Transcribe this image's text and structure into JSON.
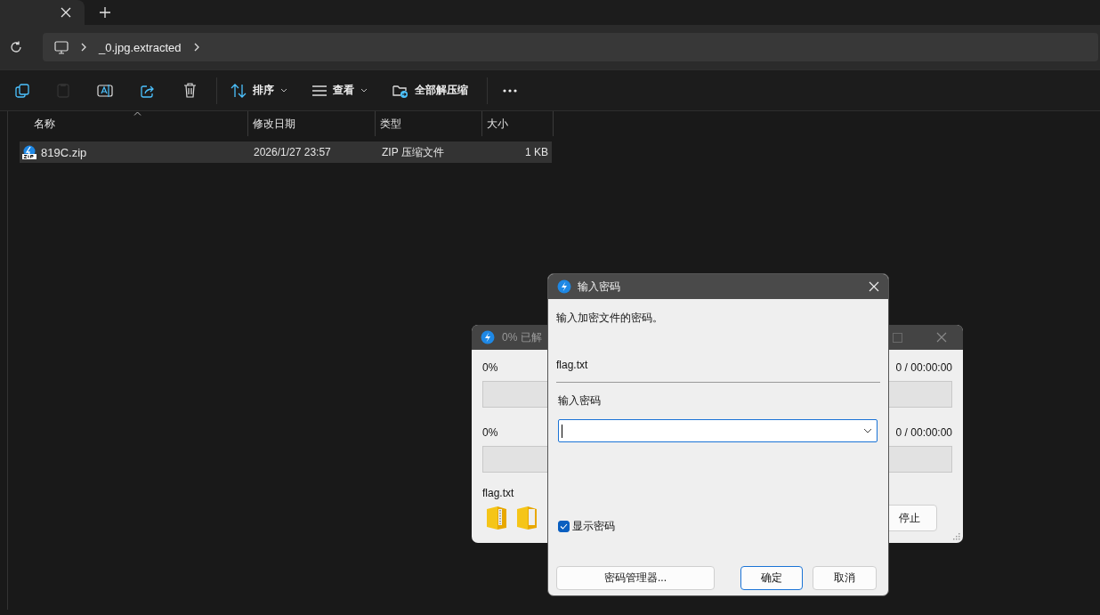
{
  "address_bar": {
    "segments": [
      "_0.jpg.extracted"
    ]
  },
  "toolbar": {
    "buttons": [
      {
        "kind": "copy",
        "disabled": false
      },
      {
        "kind": "paste",
        "disabled": true
      },
      {
        "kind": "rename",
        "disabled": false
      },
      {
        "kind": "share",
        "disabled": false
      },
      {
        "kind": "delete",
        "disabled": false
      },
      {
        "kind": "sort",
        "label": "排序",
        "has_menu": true
      },
      {
        "kind": "view",
        "label": "查看",
        "has_menu": true
      },
      {
        "kind": "extract",
        "label": "全部解压缩",
        "has_menu": false
      },
      {
        "kind": "more",
        "disabled": false
      }
    ]
  },
  "table": {
    "columns": [
      {
        "label": "名称",
        "sorted": true
      },
      {
        "label": "修改日期",
        "sorted": false
      },
      {
        "label": "类型",
        "sorted": false
      },
      {
        "label": "大小",
        "sorted": false
      }
    ],
    "rows": [
      {
        "name": "819C.zip",
        "modified": "2026/1/27 23:57",
        "type": "ZIP 压缩文件",
        "size": "1 KB",
        "selected": true
      }
    ]
  },
  "progress_window": {
    "title": "0% 已解",
    "rows": [
      {
        "percent": "0%",
        "time": "0 / 00:00:00",
        "level": 0
      },
      {
        "percent": "0%",
        "time": "0 / 00:00:00",
        "level": 0
      }
    ],
    "file": "flag.txt",
    "stop_button": "停止"
  },
  "password_dialog": {
    "title": "输入密码",
    "prompt": "输入加密文件的密码。",
    "file": "flag.txt",
    "field_label": "输入密码",
    "show_password": {
      "label": "显示密码",
      "checked": true
    },
    "buttons": [
      {
        "label": "密码管理器...",
        "default": false
      },
      {
        "label": "确定",
        "default": true
      },
      {
        "label": "取消",
        "default": false
      }
    ]
  }
}
